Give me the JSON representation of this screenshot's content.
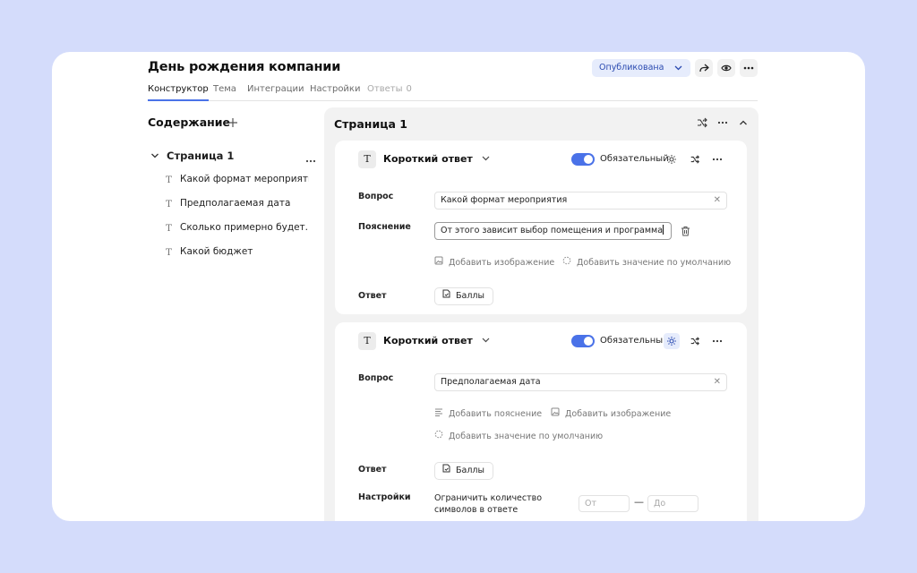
{
  "header": {
    "title": "День рождения компании",
    "publish_label": "Опубликована",
    "tabs": [
      {
        "label": "Конструктор",
        "state": "active"
      },
      {
        "label": "Тема",
        "state": "normal"
      },
      {
        "label": "Интеграции",
        "state": "normal"
      },
      {
        "label": "Настройки",
        "state": "normal"
      },
      {
        "label": "Ответы",
        "state": "disabled",
        "count": "0"
      }
    ],
    "icons": [
      "share-icon",
      "eye-icon",
      "more-icon"
    ]
  },
  "sidebar": {
    "title": "Содержание",
    "page": {
      "label": "Страница 1",
      "items": [
        {
          "label": "Какой формат мероприятия"
        },
        {
          "label": "Предполагаемая дата"
        },
        {
          "label": "Сколько примерно будет..."
        },
        {
          "label": "Какой бюджет"
        }
      ]
    }
  },
  "panel": {
    "title": "Страница 1",
    "questions": [
      {
        "type_icon": "T",
        "type_label": "Короткий ответ",
        "required_label": "Обязательный",
        "required": true,
        "question_label": "Вопрос",
        "question_value": "Какой формат мероприятия",
        "hint_label": "Пояснение",
        "hint_value": "От этого зависит выбор помещения и программа",
        "add_image": "Добавить изображение",
        "add_default": "Добавить значение по умолчанию",
        "answer_label": "Ответ",
        "answer_button": "Баллы"
      },
      {
        "type_icon": "T",
        "type_label": "Короткий ответ",
        "required_label": "Обязательный",
        "required": true,
        "question_label": "Вопрос",
        "question_value": "Предполагаемая дата",
        "add_hint": "Добавить пояснение",
        "add_image": "Добавить изображение",
        "add_default": "Добавить значение по умолчанию",
        "answer_label": "Ответ",
        "answer_button": "Баллы",
        "settings_label": "Настройки",
        "limit_label": "Ограничить количество символов в ответе",
        "from_placeholder": "От",
        "to_placeholder": "До",
        "range_dash": "—"
      }
    ]
  },
  "colors": {
    "background": "#d4dcfb",
    "accent": "#4a72e8",
    "publish_bg": "#e6ecfc"
  }
}
